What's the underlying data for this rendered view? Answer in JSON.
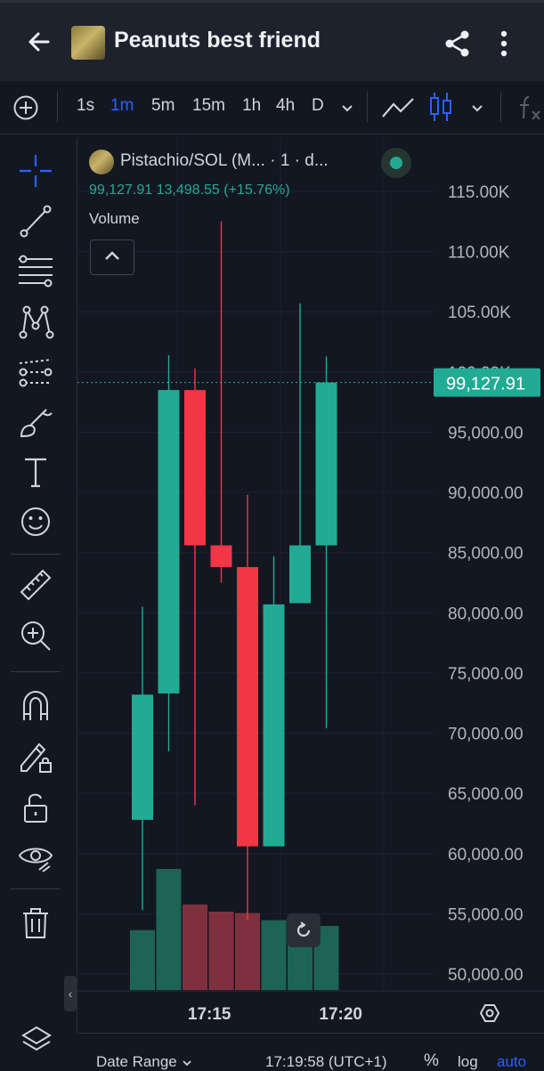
{
  "header": {
    "title": "Peanuts best friend"
  },
  "toolbar": {
    "intervals": [
      "1s",
      "1m",
      "5m",
      "15m",
      "1h",
      "4h",
      "D"
    ],
    "active_interval": "1m"
  },
  "legend": {
    "title": "Pistachio/SOL (M... · 1 · d...",
    "values": "99,127.91  13,498.55 (+15.76%)",
    "volume_label": "Volume"
  },
  "chart_data": {
    "type": "candlestick",
    "ylim": [
      48000,
      118000
    ],
    "y_ticks": [
      "115.00K",
      "110.00K",
      "105.00K",
      "100.00K",
      "95,000.00",
      "90,000.00",
      "85,000.00",
      "80,000.00",
      "75,000.00",
      "70,000.00",
      "65,000.00",
      "60,000.00",
      "55,000.00",
      "50,000.00"
    ],
    "y_tick_values": [
      115000,
      110000,
      105000,
      100000,
      95000,
      90000,
      85000,
      80000,
      75000,
      70000,
      65000,
      60000,
      55000,
      50000
    ],
    "x_ticks": [
      "17:15",
      "17:20"
    ],
    "x_tick_index": [
      2.55,
      7.55
    ],
    "current_price_label": "99,127.91",
    "current_price": 99127.91,
    "candles": [
      {
        "o": 62800,
        "h": 80500,
        "l": 55300,
        "c": 73200,
        "vol": 0.42
      },
      {
        "o": 73300,
        "h": 101400,
        "l": 68500,
        "c": 98500,
        "vol": 0.85
      },
      {
        "o": 98500,
        "h": 100300,
        "l": 64000,
        "c": 85600,
        "vol": 0.6
      },
      {
        "o": 85600,
        "h": 112500,
        "l": 82500,
        "c": 83800,
        "vol": 0.55
      },
      {
        "o": 83800,
        "h": 89800,
        "l": 54500,
        "c": 60600,
        "vol": 0.54
      },
      {
        "o": 60600,
        "h": 84700,
        "l": 60600,
        "c": 80700,
        "vol": 0.49
      },
      {
        "o": 80800,
        "h": 105700,
        "l": 80800,
        "c": 85600,
        "vol": 0.45
      },
      {
        "o": 85600,
        "h": 101300,
        "l": 70400,
        "c": 99127.91,
        "vol": 0.45
      }
    ]
  },
  "bottombar": {
    "date_range": "Date Range",
    "time": "17:19:58 (UTC+1)",
    "percent": "%",
    "log": "log",
    "auto": "auto"
  },
  "colors": {
    "up": "#22ab94",
    "down": "#f23645",
    "accent": "#2962ff"
  }
}
